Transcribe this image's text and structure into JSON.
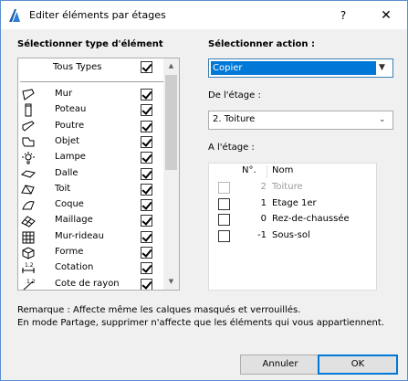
{
  "window": {
    "title": "Editer éléments par étages",
    "help_glyph": "?",
    "close_glyph": "✕"
  },
  "left": {
    "section_title": "Sélectionner type d'élément",
    "all_types": {
      "label": "Tous Types",
      "checked": true
    },
    "items": [
      {
        "label": "Mur",
        "icon": "wall-icon",
        "checked": true
      },
      {
        "label": "Poteau",
        "icon": "column-icon",
        "checked": true
      },
      {
        "label": "Poutre",
        "icon": "beam-icon",
        "checked": true
      },
      {
        "label": "Objet",
        "icon": "object-icon",
        "checked": true
      },
      {
        "label": "Lampe",
        "icon": "lamp-icon",
        "checked": true
      },
      {
        "label": "Dalle",
        "icon": "slab-icon",
        "checked": true
      },
      {
        "label": "Toit",
        "icon": "roof-icon",
        "checked": true
      },
      {
        "label": "Coque",
        "icon": "shell-icon",
        "checked": true
      },
      {
        "label": "Maillage",
        "icon": "mesh-icon",
        "checked": true
      },
      {
        "label": "Mur-rideau",
        "icon": "curtain-wall-icon",
        "checked": true
      },
      {
        "label": "Forme",
        "icon": "morph-icon",
        "checked": true
      },
      {
        "label": "Cotation",
        "icon": "dimension-icon",
        "checked": true
      },
      {
        "label": "Cote de rayon",
        "icon": "radial-dimension-icon",
        "checked": true
      }
    ]
  },
  "right": {
    "action_title": "Sélectionner action :",
    "action_value": "Copier",
    "from_label": "De l'étage :",
    "from_value": "2. Toiture",
    "to_label": "A l'étage :",
    "table_headers": {
      "num": "N°.",
      "name": "Nom"
    },
    "stories": [
      {
        "num": "2",
        "name": "Toiture",
        "checked": false,
        "disabled": true
      },
      {
        "num": "1",
        "name": "Etage 1er",
        "checked": false,
        "disabled": false
      },
      {
        "num": "0",
        "name": "Rez-de-chaussée",
        "checked": false,
        "disabled": false
      },
      {
        "num": "-1",
        "name": "Sous-sol",
        "checked": false,
        "disabled": false
      }
    ]
  },
  "remarks": {
    "line1": "Remarque : Affecte même les calques masqués et verrouillés.",
    "line2": "En mode Partage, supprimer n'affecte que les éléments qui vous appartiennent."
  },
  "buttons": {
    "cancel": "Annuler",
    "ok": "OK"
  },
  "colors": {
    "accent": "#0078d7",
    "window_border": "#5a8fd0",
    "dialog_bg": "#f0f0f0"
  }
}
